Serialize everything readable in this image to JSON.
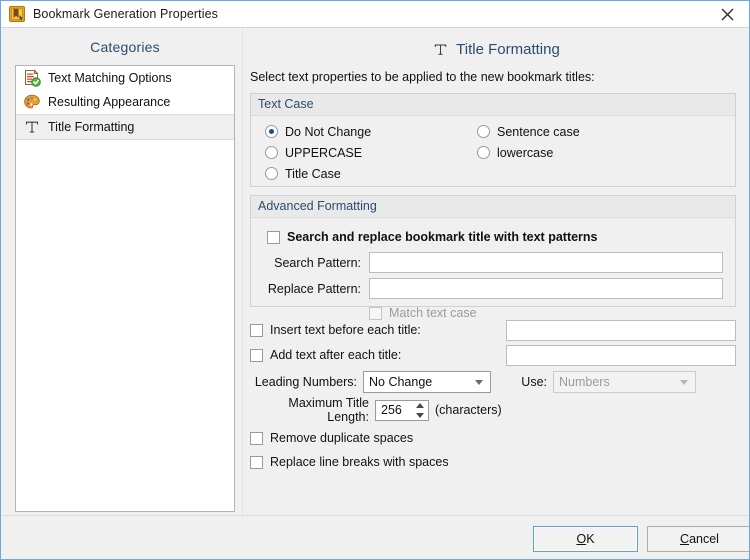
{
  "window": {
    "title": "Bookmark Generation Properties",
    "icon": "bookmark-properties-icon",
    "close_label": "✕"
  },
  "sidebar": {
    "title": "Categories",
    "items": [
      {
        "label": "Text Matching Options",
        "icon": "text-matching-icon",
        "selected": false
      },
      {
        "label": "Resulting Appearance",
        "icon": "palette-icon",
        "selected": false
      },
      {
        "label": "Title Formatting",
        "icon": "title-formatting-icon",
        "selected": true
      }
    ]
  },
  "main": {
    "header_title": "Title Formatting",
    "header_icon": "T",
    "subtitle": "Select text properties to be applied to the new bookmark titles:",
    "text_case": {
      "group_label": "Text Case",
      "options_left": [
        {
          "label": "Do Not Change",
          "checked": true
        },
        {
          "label": "UPPERCASE",
          "checked": false
        },
        {
          "label": "Title Case",
          "checked": false
        }
      ],
      "options_right": [
        {
          "label": "Sentence case",
          "checked": false
        },
        {
          "label": "lowercase",
          "checked": false
        }
      ]
    },
    "advanced_formatting": {
      "group_label": "Advanced Formatting",
      "search_replace_label": "Search and replace bookmark title with text patterns",
      "search_replace_checked": false,
      "search_pattern_label": "Search Pattern:",
      "search_pattern_value": "",
      "replace_pattern_label": "Replace Pattern:",
      "replace_pattern_value": "",
      "match_text_case_label": "Match text case",
      "match_text_case_checked": false,
      "match_text_case_disabled": true
    },
    "insert_before": {
      "label": "Insert text before each title:",
      "checked": false,
      "value": ""
    },
    "add_after": {
      "label": "Add text after each title:",
      "checked": false,
      "value": ""
    },
    "leading_numbers": {
      "label": "Leading Numbers:",
      "value": "No Change"
    },
    "use_numbers": {
      "label": "Use:",
      "value": "Numbers",
      "disabled": true
    },
    "max_title_length": {
      "label": "Maximum Title Length:",
      "value": "256",
      "suffix": "(characters)"
    },
    "remove_duplicate_spaces": {
      "label": "Remove duplicate spaces",
      "checked": false
    },
    "replace_line_breaks": {
      "label": "Replace line breaks with spaces",
      "checked": false
    }
  },
  "footer": {
    "ok_before": "O",
    "ok_mnemonic": "O",
    "ok_label": "OK",
    "ok_rest": "K",
    "cancel_mnemonic": "C",
    "cancel_label": "Cancel",
    "cancel_rest": "ancel"
  },
  "colors": {
    "accent_blue": "#2a4c6e",
    "window_border": "#6ea8dc",
    "group_header_bg": "#e9e9e9",
    "radio_dot": "#1c4f8f",
    "default_button_border": "#5ba0e0"
  }
}
